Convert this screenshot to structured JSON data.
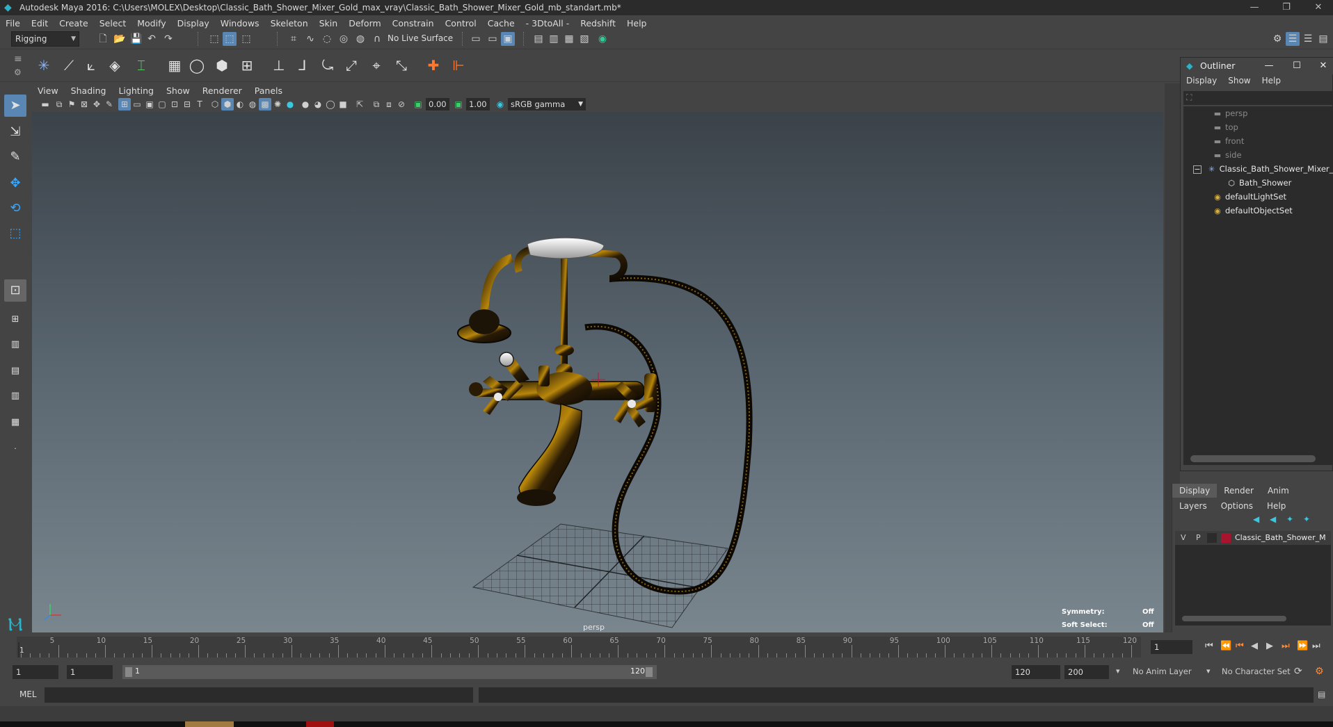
{
  "window": {
    "title": "Autodesk Maya 2016: C:\\Users\\MOLEX\\Desktop\\Classic_Bath_Shower_Mixer_Gold_max_vray\\Classic_Bath_Shower_Mixer_Gold_mb_standart.mb*",
    "minimize": "—",
    "restore": "❐",
    "close": "✕"
  },
  "menubar": [
    "File",
    "Edit",
    "Create",
    "Select",
    "Modify",
    "Display",
    "Windows",
    "Skeleton",
    "Skin",
    "Deform",
    "Constrain",
    "Control",
    "Cache",
    "- 3DtoAll -",
    "Redshift",
    "Help"
  ],
  "statusline": {
    "menuset": "Rigging",
    "live_surface": "No Live Surface"
  },
  "viewport": {
    "menus": [
      "View",
      "Shading",
      "Lighting",
      "Show",
      "Renderer",
      "Panels"
    ],
    "exposure": "0.00",
    "gamma": "1.00",
    "color_space": "sRGB gamma",
    "camera_label": "persp",
    "hud": {
      "symmetry_label": "Symmetry:",
      "symmetry_value": "Off",
      "soft_select_label": "Soft Select:",
      "soft_select_value": "Off"
    },
    "colors": {
      "metal": "#1a1206",
      "gold_highlight": "#b8860b",
      "grid": "#3a3f44",
      "manip_red": "#c8102e"
    }
  },
  "outliner": {
    "title": "Outliner",
    "menus": [
      "Display",
      "Show",
      "Help"
    ],
    "items": [
      {
        "label": "persp",
        "dim": true,
        "icon": "camera-icon"
      },
      {
        "label": "top",
        "dim": true,
        "icon": "camera-icon"
      },
      {
        "label": "front",
        "dim": true,
        "icon": "camera-icon"
      },
      {
        "label": "side",
        "dim": true,
        "icon": "camera-icon"
      },
      {
        "label": "Classic_Bath_Shower_Mixer_",
        "dim": false,
        "icon": "group-icon"
      },
      {
        "label": "Bath_Shower",
        "dim": false,
        "icon": "mesh-icon"
      },
      {
        "label": "defaultLightSet",
        "dim": false,
        "icon": "set-icon"
      },
      {
        "label": "defaultObjectSet",
        "dim": false,
        "icon": "set-icon"
      }
    ]
  },
  "layer_editor": {
    "tabs": [
      "Display",
      "Render",
      "Anim"
    ],
    "menus": [
      "Layers",
      "Options",
      "Help"
    ],
    "layer": {
      "v": "V",
      "p": "P",
      "name": "Classic_Bath_Shower_M",
      "color": "#a8142e"
    }
  },
  "timeslider": {
    "labels": [
      "5",
      "10",
      "15",
      "20",
      "25",
      "30",
      "35",
      "40",
      "45",
      "50",
      "55",
      "60",
      "65",
      "70",
      "75",
      "80",
      "85",
      "90",
      "95",
      "100",
      "105",
      "110",
      "115",
      "120"
    ],
    "current_frame": "1",
    "start_label": "1"
  },
  "rangeslider": {
    "start": "1",
    "playback_start": "1",
    "range_start": "1",
    "range_end": "120",
    "playback_end": "120",
    "end": "200",
    "anim_layer": "No Anim Layer",
    "character_set": "No Character Set"
  },
  "cmdline": {
    "language": "MEL"
  }
}
